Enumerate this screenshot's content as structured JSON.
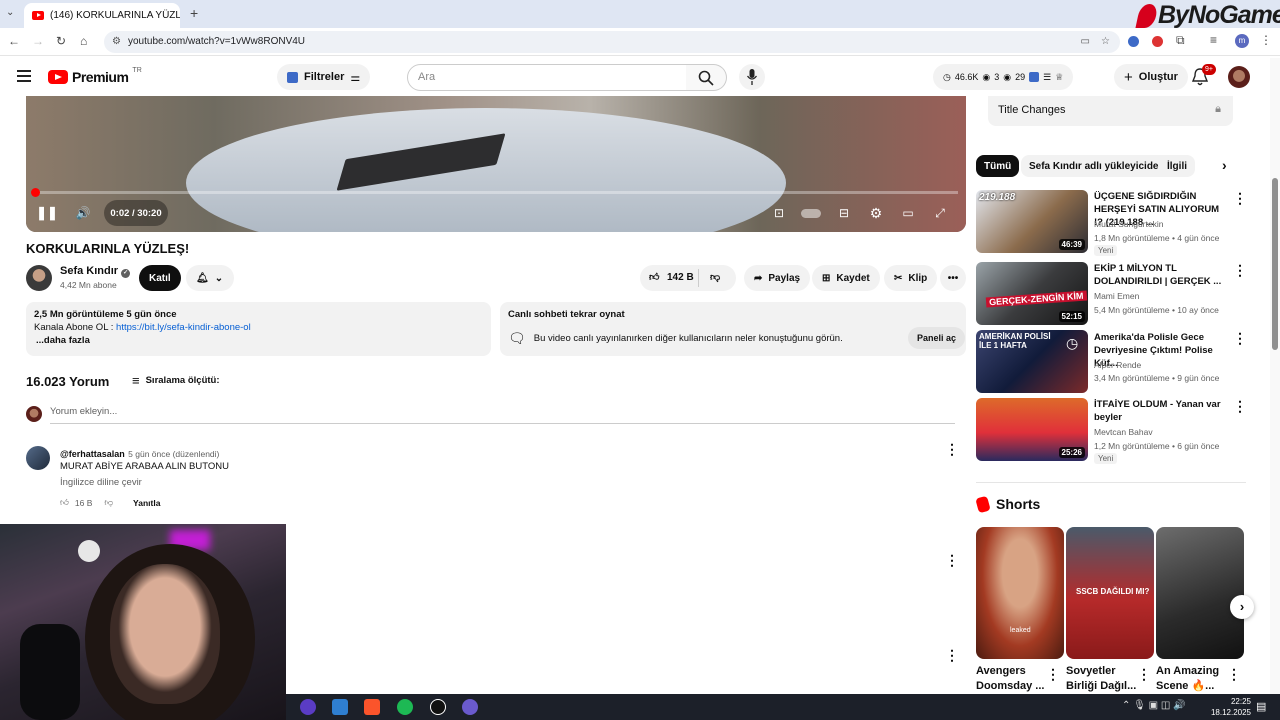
{
  "browser": {
    "tab_title": "(146) KORKULARINLA YÜZL",
    "url": "youtube.com/watch?v=1vWw8RONV4U",
    "watermark": "ByNoGame",
    "new_tab": "+"
  },
  "yt": {
    "logo_text": "Premium",
    "region": "TR",
    "filters_label": "Filtreler",
    "search_placeholder": "Ara",
    "stats": {
      "views": "46.6K",
      "viewers": "3",
      "watch": "29"
    },
    "create_label": "Oluştur",
    "notif_badge": "9+",
    "avatar_letter": "m"
  },
  "player": {
    "time": "0:02 / 30:20",
    "progress_pct": 0.1
  },
  "video": {
    "title": "KORKULARINLA YÜZLEŞ!",
    "channel": "Sefa Kındır",
    "subs": "4,42 Mn abone",
    "join_label": "Katıl",
    "likes": "142 B",
    "share_label": "Paylaş",
    "save_label": "Kaydet",
    "clip_label": "Klip"
  },
  "description": {
    "stats": "2,5 Mn görüntüleme  5 gün önce",
    "line1_prefix": "Kanala Abone OL : ",
    "link": "https://bit.ly/sefa-kindir-abone-ol",
    "more": "...daha fazla"
  },
  "chat": {
    "title": "Canlı sohbeti tekrar oynat",
    "text": "Bu video canlı yayınlanırken diğer kullanıcıların neler konuştuğunu görün.",
    "button": "Paneli aç"
  },
  "comments": {
    "count": "16.023 Yorum",
    "sort_label": "Sıralama ölçütü:",
    "add_placeholder": "Yorum ekleyin...",
    "first": {
      "author": "@ferhattasalan",
      "time": "5 gün önce (düzenlendi)",
      "text": "MURAT ABİYE ARABAA ALIN BUTONU",
      "translate": "İngilizce diline çevir",
      "likes": "16 B",
      "reply": "Yanıtla"
    }
  },
  "sidebar": {
    "title_changes": "Title Changes",
    "chips": [
      "Tümü",
      "Sefa Kındır adlı yükleyiciden",
      "İlgili"
    ],
    "items": [
      {
        "title": "ÜÇGENE SIĞDIRDIĞIN HERŞEYİ SATIN ALIYORUM !? (219.188 ...",
        "channel": "Murat Sungurtekin",
        "meta": "1,8 Mn görüntüleme  •  4 gün önce",
        "badge": "Yeni",
        "duration": "46:39",
        "thumb_text": "219.188"
      },
      {
        "title": "EKİP 1 MİLYON TL DOLANDIRILDI | GERÇEK ...",
        "channel": "Mami Emen",
        "meta": "5,4 Mn görüntüleme  •  10 ay önce",
        "badge": "",
        "duration": "52:15",
        "thumb_text": "GERÇEK-ZENGİN KİM"
      },
      {
        "title": "Amerika'da Polisle Gece Devriyesine Çıktım! Polise Küf...",
        "channel": "Alper Rende",
        "meta": "3,4 Mn görüntüleme  •  9 gün önce",
        "badge": "",
        "duration": "",
        "thumb_text": "AMERİKAN POLİSİ İLE 1 HAFTA"
      },
      {
        "title": "İTFAİYE OLDUM - Yanan var beyler",
        "channel": "Mevtcan Bahav",
        "meta": "1,2 Mn görüntüleme  •  6 gün önce",
        "badge": "Yeni",
        "duration": "25:26",
        "thumb_text": ""
      }
    ],
    "shorts_label": "Shorts",
    "shorts": [
      {
        "title": "Avengers Doomsday ...",
        "overlay": "leaked"
      },
      {
        "title": "Sovyetler Birliği Dağıl...",
        "overlay": "SSCB DAĞILDI MI?"
      },
      {
        "title": "An Amazing Scene 🔥...",
        "overlay": ""
      }
    ]
  },
  "taskbar": {
    "time": "22:25",
    "date": "18.12.2025"
  }
}
